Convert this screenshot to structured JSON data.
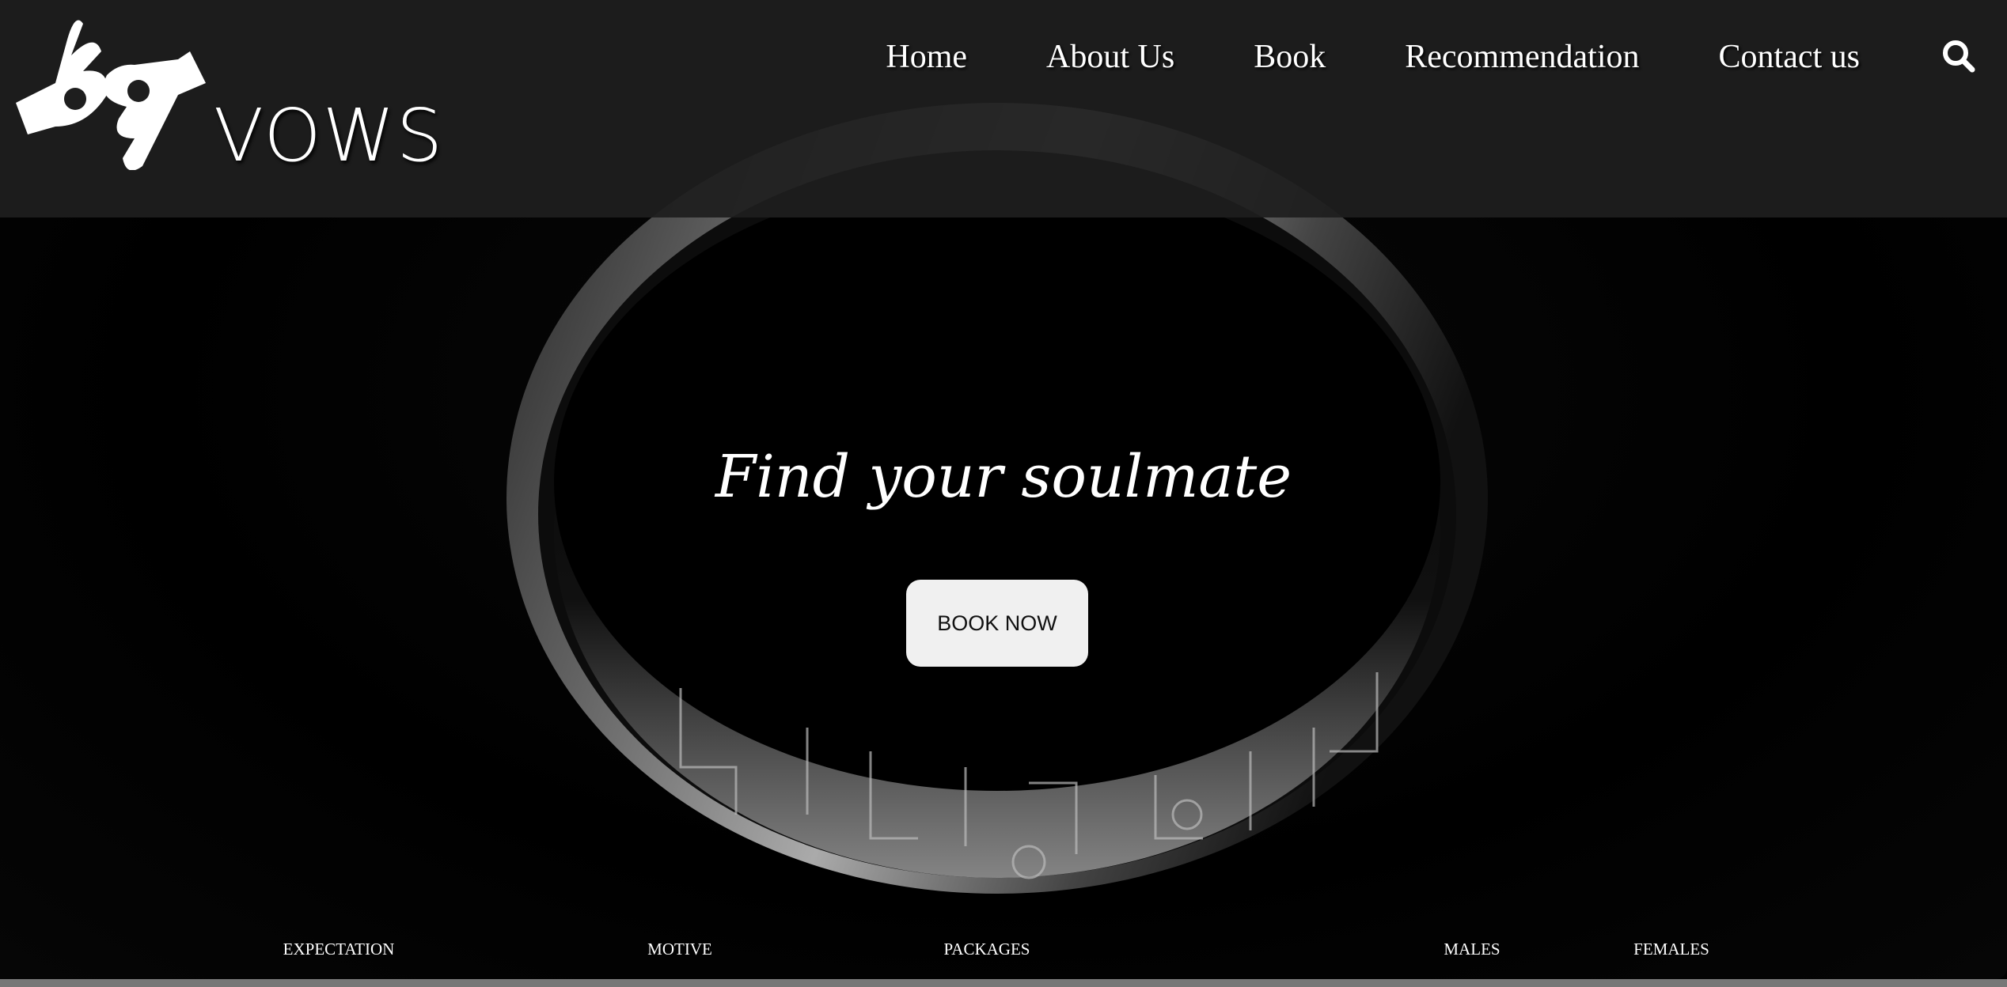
{
  "header": {
    "logo_text": "VOWS",
    "nav": [
      "Home",
      "About Us",
      "Book",
      "Recommendation",
      "Contact us"
    ],
    "search_icon": "search-icon"
  },
  "hero": {
    "title": "Find your soulmate",
    "button": "BOOK NOW"
  },
  "footer_links": [
    "EXPECTATION",
    "MOTIVE",
    "PACKAGES",
    "MALES",
    "FEMALES"
  ]
}
